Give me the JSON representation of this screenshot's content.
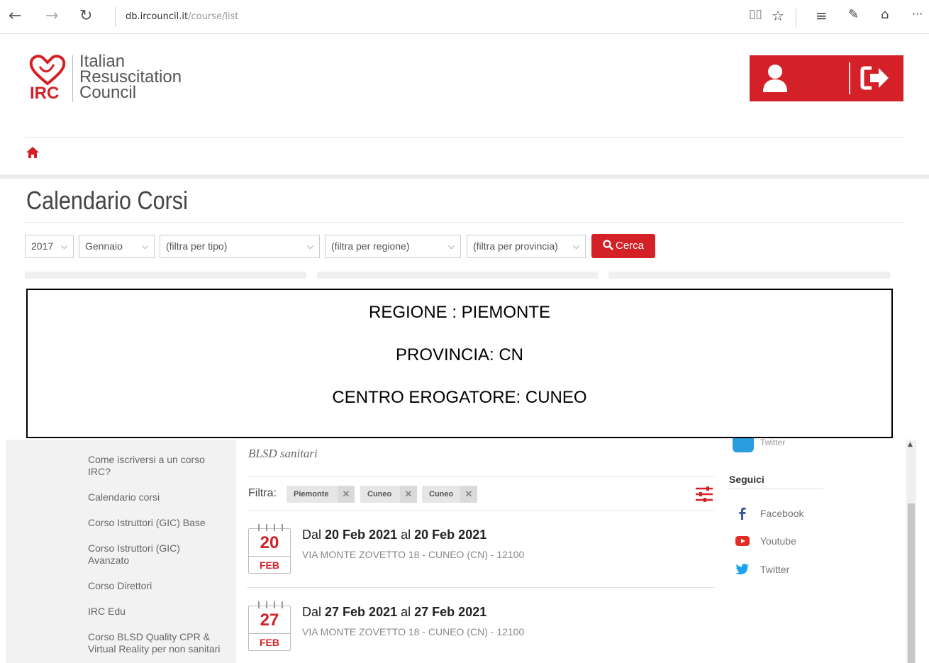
{
  "browser": {
    "url_domain": "db.ircouncil.it",
    "url_path": "/course/list",
    "back": "←",
    "forward": "→",
    "refresh": "↻",
    "more": "···"
  },
  "brand": {
    "abbr": "IRC",
    "line1": "Italian",
    "line2": "Resuscitation",
    "line3": "Council",
    "red": "#d42027"
  },
  "page": {
    "title": "Calendario Corsi"
  },
  "filters": {
    "year": "2017",
    "month": "Gennaio",
    "type": "(filtra per tipo)",
    "region": "(filtra per regione)",
    "province": "(filtra per provincia)",
    "search_label": "Cerca"
  },
  "overlay": {
    "line1": "REGIONE : PIEMONTE",
    "line2": "PROVINCIA: CN",
    "line3": "CENTRO EROGATORE: CUNEO"
  },
  "sidebar": {
    "items": [
      "Come iscriversi a un corso IRC?",
      "Calendario corsi",
      "Corso Istruttori (GIC) Base",
      "Corso Istruttori (GIC) Avanzato",
      "Corso Direttori",
      "IRC Edu",
      "Corso BLSD Quality CPR & Virtual Reality per non sanitari"
    ]
  },
  "content": {
    "subtitle": "BLSD sanitari",
    "filtra_label": "Filtra:",
    "chips": [
      "Piemonte",
      "Cuneo",
      "Cuneo"
    ],
    "events": [
      {
        "day": "20",
        "month": "FEB",
        "prefix": "Dal",
        "start": "20 Feb 2021",
        "mid": "al",
        "end": "20 Feb 2021",
        "address": "VIA MONTE ZOVETTO 18 - CUNEO (CN) - 12100"
      },
      {
        "day": "27",
        "month": "FEB",
        "prefix": "Dal",
        "start": "27 Feb 2021",
        "mid": "al",
        "end": "27 Feb 2021",
        "address": "VIA MONTE ZOVETTO 18 - CUNEO (CN) - 12100"
      }
    ]
  },
  "right": {
    "twitter_top": "Twitter",
    "follow_title": "Seguici",
    "social": [
      "Facebook",
      "Youtube",
      "Twitter"
    ]
  }
}
